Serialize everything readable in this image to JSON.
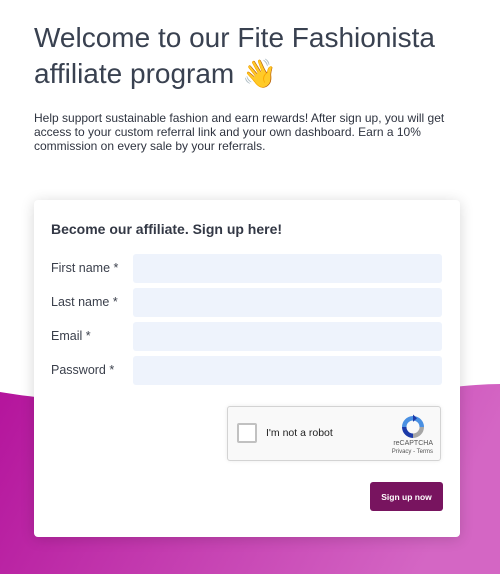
{
  "header": {
    "title": "Welcome to our Fite Fashionista affiliate program",
    "title_emoji": "👋",
    "intro": "Help support sustainable fashion and earn rewards! After sign up, you will get access to your custom referral link and your own dashboard. Earn a 10% commission on every sale by your referrals."
  },
  "form": {
    "title": "Become our affiliate. Sign up here!",
    "fields": [
      {
        "label": "First name *",
        "value": "",
        "placeholder": ""
      },
      {
        "label": "Last name *",
        "value": "",
        "placeholder": ""
      },
      {
        "label": "Email *",
        "value": "",
        "placeholder": ""
      },
      {
        "label": "Password *",
        "value": "",
        "placeholder": ""
      }
    ],
    "captcha": {
      "label": "I'm not a robot",
      "brand": "reCAPTCHA",
      "links": "Privacy - Terms",
      "checked": false
    },
    "submit_label": "Sign up now"
  },
  "colors": {
    "wave_start": "#b4149c",
    "wave_end": "#d466c4",
    "button": "#78145f",
    "input_bg": "#eef3fc"
  },
  "icons": {
    "captcha_logo": "recaptcha-icon",
    "emoji": "waving-hand-icon"
  }
}
